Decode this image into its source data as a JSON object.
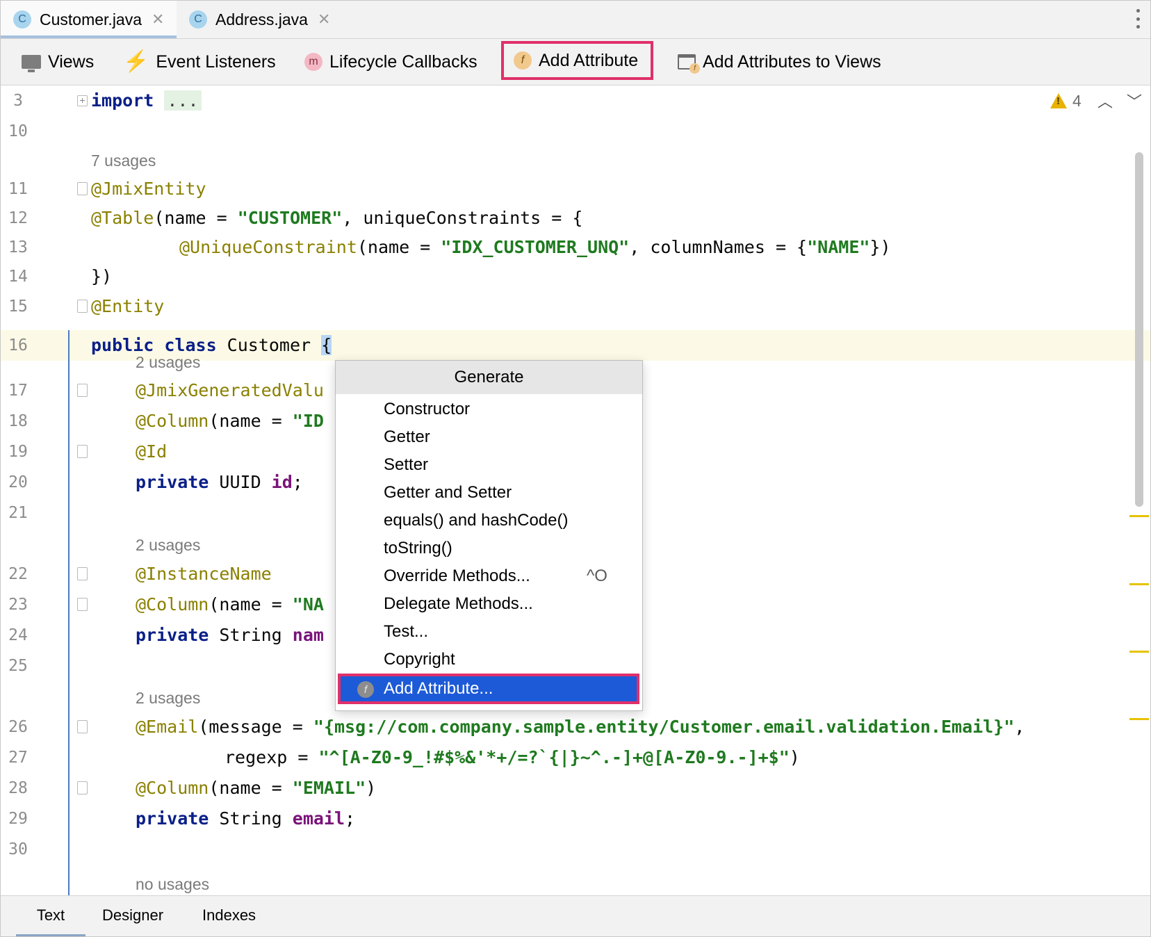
{
  "tabs": [
    {
      "label": "Customer.java",
      "icon": "C",
      "active": true
    },
    {
      "label": "Address.java",
      "icon": "C",
      "active": false
    }
  ],
  "toolbar": {
    "views": "Views",
    "event_listeners": "Event Listeners",
    "lifecycle_callbacks": "Lifecycle Callbacks",
    "lifecycle_icon": "m",
    "add_attribute": "Add Attribute",
    "add_attribute_icon": "f",
    "add_attributes_to_views": "Add Attributes to Views"
  },
  "editor": {
    "warnings_count": "4",
    "line_numbers": {
      "l3": "3",
      "l10": "10",
      "l11": "11",
      "l12": "12",
      "l13": "13",
      "l14": "14",
      "l15": "15",
      "l16": "16",
      "l17": "17",
      "l18": "18",
      "l19": "19",
      "l20": "20",
      "l21": "21",
      "l22": "22",
      "l23": "23",
      "l24": "24",
      "l25": "25",
      "l26": "26",
      "l27": "27",
      "l28": "28",
      "l29": "29",
      "l30": "30"
    },
    "usages": {
      "u7": "7 usages",
      "u2a": "2 usages",
      "u2b": "2 usages",
      "u2c": "2 usages",
      "none": "no usages"
    },
    "code": {
      "import_kw": "import",
      "import_hint": "...",
      "jmix_entity": "@JmixEntity",
      "table_ann": "@Table",
      "table_rest1": "(name = ",
      "table_str": "\"CUSTOMER\"",
      "table_rest2": ", uniqueConstraints = {",
      "uc_ann": "@UniqueConstraint",
      "uc_rest1": "(name = ",
      "uc_str1": "\"IDX_CUSTOMER_UNQ\"",
      "uc_rest2": ", columnNames = {",
      "uc_str2": "\"NAME\"",
      "uc_rest3": "})",
      "close_l14": "})",
      "entity_ann": "@Entity",
      "public_kw": "public class",
      "class_name": " Customer ",
      "brace": "{",
      "jmix_gen": "@JmixGeneratedValu",
      "col_ann": "@Column",
      "col_id_rest": "(name = ",
      "col_id_str": "\"ID",
      "id_ann": "@Id",
      "private_kw": "private",
      "uuid_type": " UUID ",
      "id_field": "id",
      "semicolon": ";",
      "instance_name": "@InstanceName",
      "col_name_str": "\"NA",
      "string_type": " String ",
      "name_field": "nam",
      "email_ann": "@Email",
      "email_rest": "(message = ",
      "email_msg": "\"{msg://com.company.sample.entity/Customer.email.validation.Email}\"",
      "comma": ",",
      "regexp_lbl": "regexp = ",
      "regexp_str": "\"^[A-Z0-9_!#$%&'*+/=?`{|}~^.-]+@[A-Z0-9.-]+$\"",
      "paren_close": ")",
      "col_email_str": "\"EMAIL\"",
      "email_field": "email"
    }
  },
  "popup": {
    "title": "Generate",
    "items": [
      {
        "label": "Constructor"
      },
      {
        "label": "Getter"
      },
      {
        "label": "Setter"
      },
      {
        "label": "Getter and Setter"
      },
      {
        "label": "equals() and hashCode()"
      },
      {
        "label": "toString()"
      },
      {
        "label": "Override Methods...",
        "shortcut": "^O"
      },
      {
        "label": "Delegate Methods..."
      },
      {
        "label": "Test..."
      },
      {
        "label": "Copyright"
      },
      {
        "label": "Add Attribute...",
        "icon": "f",
        "selected": true
      }
    ]
  },
  "bottom_tabs": {
    "text": "Text",
    "designer": "Designer",
    "indexes": "Indexes"
  },
  "colors": {
    "highlight_border": "#e0306a",
    "selection": "#1c5ad7",
    "keyword": "#0a1f88",
    "annotation": "#8a8000",
    "string": "#1f7a1f"
  }
}
